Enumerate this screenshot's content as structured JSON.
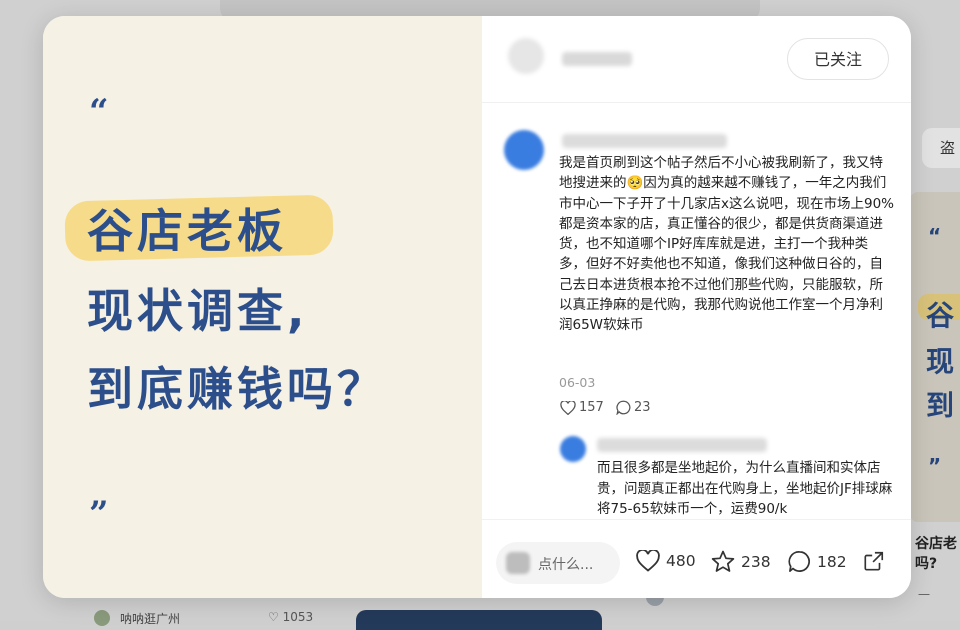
{
  "background": {
    "search_stub": "盗",
    "right_card_chars": [
      "谷",
      "现",
      "到"
    ],
    "right_card_title_line1": "谷店老",
    "right_card_title_line2": "吗?",
    "right_card_footer": "一",
    "bottom_user": "呐呐逛广州",
    "bottom_likes": "1053"
  },
  "cover": {
    "quote_open": "“",
    "line1": "谷店老板",
    "line2": "现状调查,",
    "line3": "到底赚钱吗？",
    "quote_close": "”",
    "highlight_color": "#f6dc8a",
    "text_color": "#2c4f8c"
  },
  "author": {
    "follow_label": "已关注"
  },
  "comment": {
    "text": "我是首页刷到这个帖子然后不小心被我刷新了，我又特地搜进来的🥺因为真的越来越不赚钱了，一年之内我们市中心一下子开了十几家店x这么说吧，现在市场上90%都是资本家的店，真正懂谷的很少，都是供货商渠道进货，也不知道哪个IP好库库就是进，主打一个我种类多，但好不好卖他也不知道，像我们这种做日谷的，自己去日本进货根本抢不过他们那些代购，只能服软，所以真正挣麻的是代购，我那代购说他工作室一个月净利润65W软妹币",
    "date": "06-03",
    "likes": "157",
    "replies": "23"
  },
  "reply": {
    "text": "而且很多都是坐地起价，为什么直播间和实体店贵，问题真正都出在代购身上，坐地起价JF排球麻将75-65软妹币一个，运费90/k"
  },
  "footer": {
    "input_placeholder": "点什么...",
    "likes": "480",
    "stars": "238",
    "comments": "182"
  }
}
